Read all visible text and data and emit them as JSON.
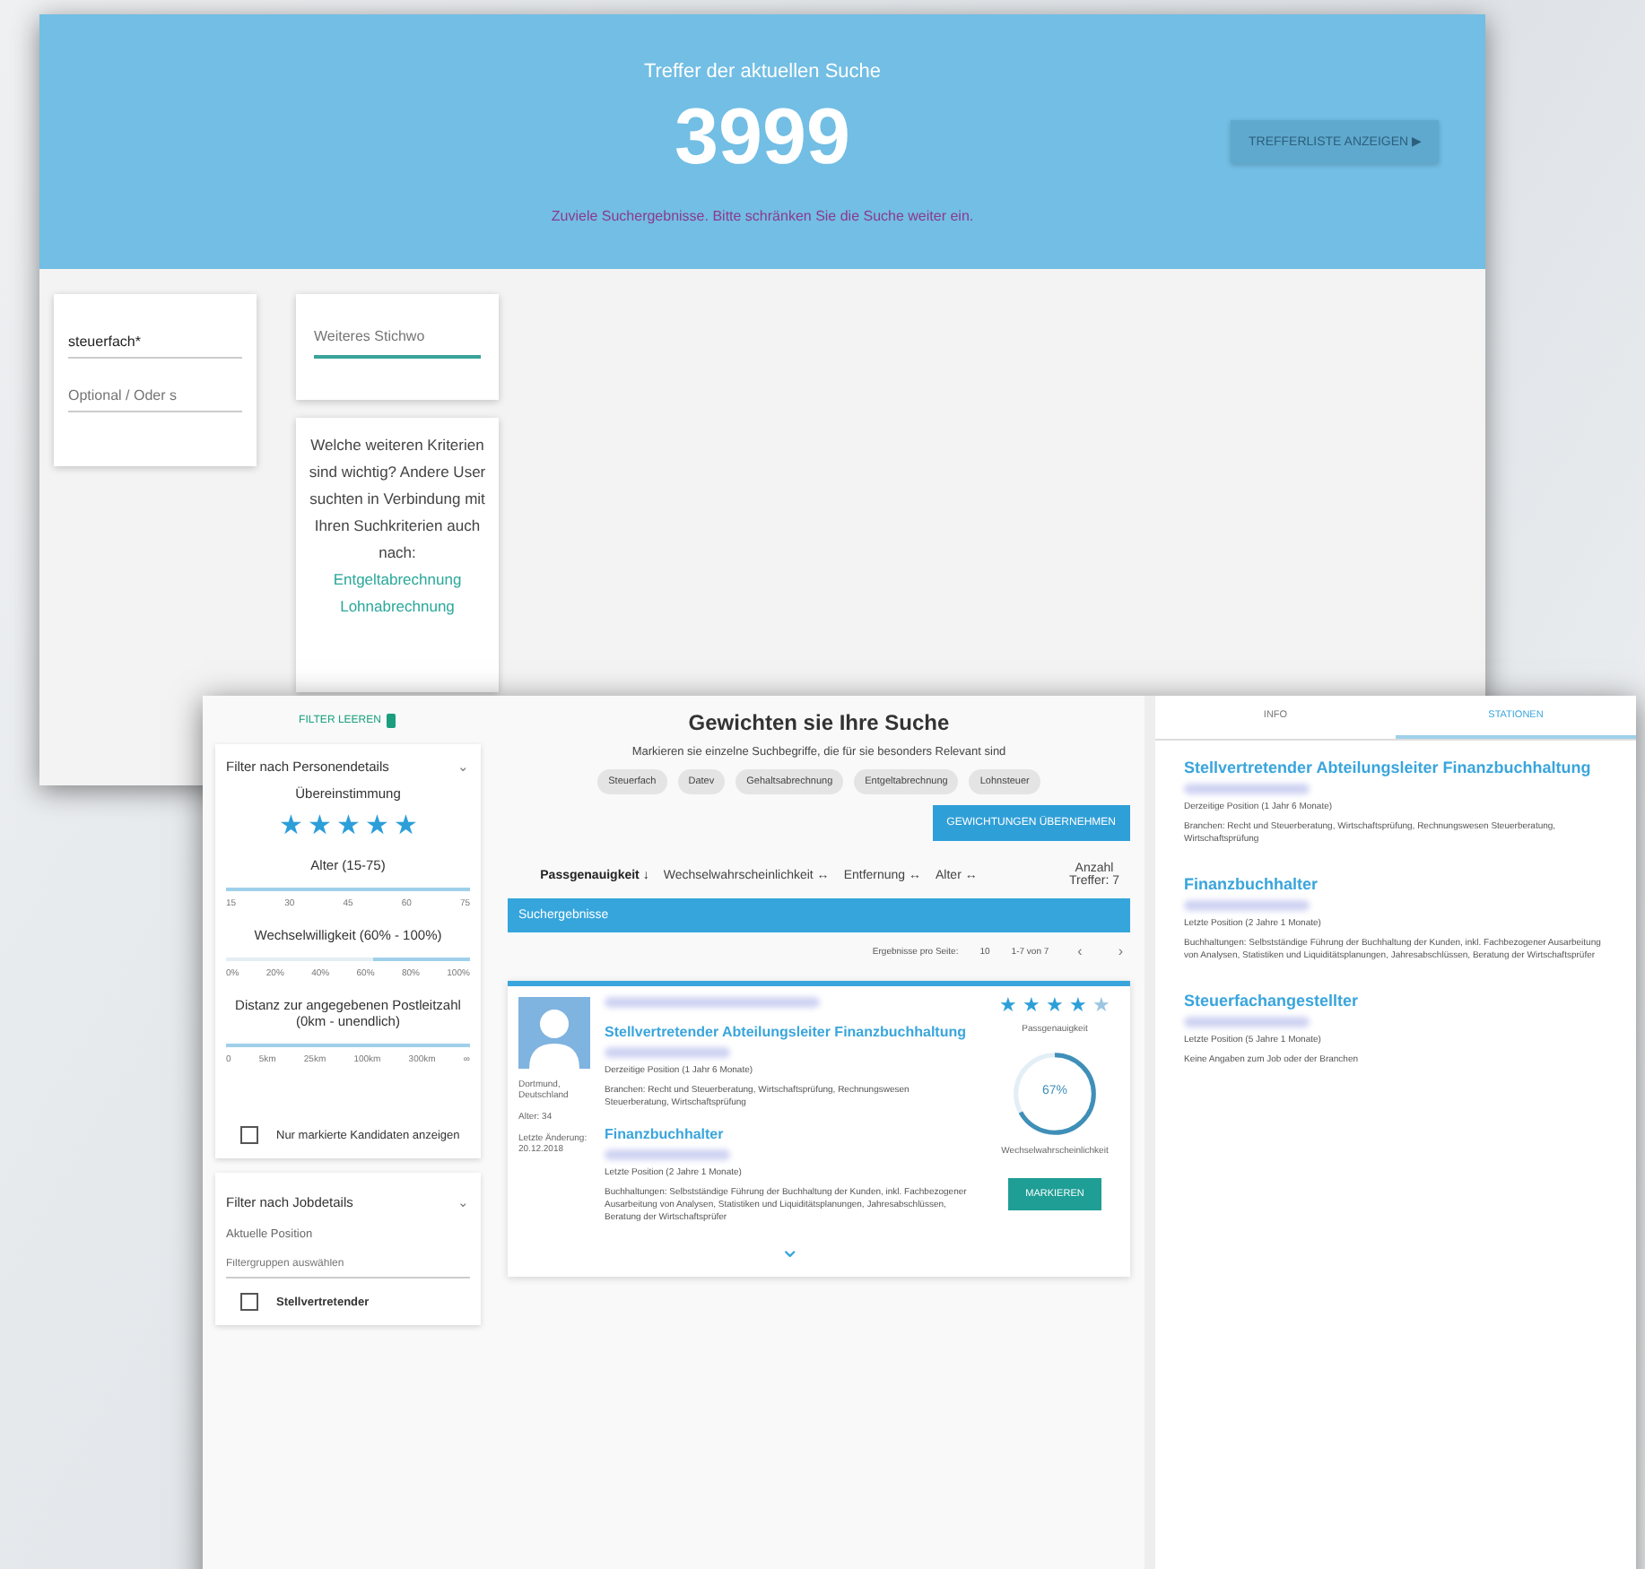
{
  "search_window": {
    "header": {
      "title": "Treffer der aktuellen Suche",
      "count": "3999",
      "button": "TREFFERLISTE ANZEIGEN ▶",
      "warning": "Zuviele Suchergebnisse. Bitte schränken Sie die Suche weiter ein."
    },
    "term_card": {
      "value": "steuerfach*",
      "placeholder": "Optional / Oder s"
    },
    "suggest_card": {
      "placeholder": "Weiteres Stichwo",
      "tooltip": "Welche weiteren Kriterien sind wichtig? Andere User suchten in Verbindung mit Ihren Suchkriterien auch nach:",
      "links": [
        "Entgeltabrechnung",
        "Lohnabrechnung"
      ]
    }
  },
  "results_window": {
    "sidebar": {
      "clear_button": "FILTER LEEREN",
      "person_filter": {
        "title": "Filter nach Personendetails",
        "toggle": "⌄",
        "match_label": "Übereinstimmung",
        "stars": 5,
        "sliders": [
          {
            "label": "Alter (15-75)",
            "level": 1,
            "ticks": [
              "15",
              "30",
              "45",
              "60",
              "75"
            ]
          },
          {
            "label": "Wechselwilligkeit (60% - 100%)",
            "level": 0.4,
            "ticks": [
              "0%",
              "20%",
              "40%",
              "60%",
              "80%",
              "100%"
            ]
          },
          {
            "label": "Distanz zur angegebenen Postleitzahl (0km - unendlich)",
            "level": 1,
            "ticks": [
              "0",
              "5km",
              "25km",
              "100km",
              "300km",
              "∞"
            ]
          }
        ],
        "only_marked": {
          "label": "Nur markierte Kandidaten anzeigen",
          "checked": false
        }
      },
      "job_filter": {
        "title": "Filter nach Jobdetails",
        "toggle": "⌄",
        "field_label": "Aktuelle Position",
        "placeholder": "Filtergruppen auswählen",
        "option": {
          "label": "Stellvertretender",
          "checked": false
        }
      }
    },
    "main": {
      "title": "Gewichten sie Ihre Suche",
      "subtitle": "Markieren sie einzelne Suchbegriffe, die für sie besonders Relevant sind",
      "chips": [
        "Steuerfach",
        "Datev",
        "Gehaltsabrechnung",
        "Entgeltabrechnung",
        "Lohnsteuer"
      ],
      "apply_button": "GEWICHTUNGEN ÜBERNEHMEN",
      "sorts": [
        {
          "label": "Passgenauigkeit ↓",
          "selected": true
        },
        {
          "label": "Wechselwahrscheinlichkeit ↔",
          "selected": false
        },
        {
          "label": "Entfernung ↔",
          "selected": false
        },
        {
          "label": "Alter ↔",
          "selected": false
        }
      ],
      "hit_count": "Anzahl Treffer: 7",
      "results_bar": "Suchergebnisse",
      "pager": {
        "per_page_label": "Ergebnisse pro Seite:",
        "per_page": "10",
        "range": "1-7 von 7",
        "prev": "‹",
        "next": "›"
      },
      "candidate": {
        "location": "Dortmund, Deutschland",
        "age": "Alter: 34",
        "changed": "Letzte Änderung: 20.12.2018",
        "stars": 4,
        "stars_label": "Passgenauigkeit",
        "percent": "67%",
        "level": 0.67,
        "gauge_label": "Wechselwahrscheinlichkeit",
        "button": "MARKIEREN",
        "expand": "⌄",
        "jobs": [
          {
            "title": "Stellvertretender Abteilungsleiter Finanzbuchhaltung",
            "period": "Derzeitige Position (1 Jahr 6 Monate)",
            "details": "Branchen: Recht und Steuerberatung, Wirtschaftsprüfung, Rechnungswesen Steuerberatung, Wirtschaftsprüfung"
          },
          {
            "title": "Finanzbuchhalter",
            "period": "Letzte Position (2 Jahre 1 Monate)",
            "details": "Buchhaltungen: Selbstständige Führung der Buchhaltung der Kunden, inkl. Fachbezogener Ausarbeitung von Analysen, Statistiken und Liquiditätsplanungen, Jahresabschlüssen, Beratung der Wirtschaftsprüfer"
          }
        ]
      }
    },
    "detail": {
      "tabs": [
        {
          "label": "INFO",
          "selected": false
        },
        {
          "label": "STATIONEN",
          "selected": true
        }
      ],
      "stations": [
        {
          "title": "Stellvertretender Abteilungsleiter Finanzbuchhaltung",
          "period": "Derzeitige Position (1 Jahr 6 Monate)",
          "details": "Branchen: Recht und Steuerberatung, Wirtschaftsprüfung, Rechnungswesen Steuerberatung, Wirtschaftsprüfung"
        },
        {
          "title": "Finanzbuchhalter",
          "period": "Letzte Position (2 Jahre 1 Monate)",
          "details": "Buchhaltungen: Selbstständige Führung der Buchhaltung der Kunden, inkl. Fachbezogener Ausarbeitung von Analysen, Statistiken und Liquiditätsplanungen, Jahresabschlüssen, Beratung der Wirtschaftsprüfer"
        },
        {
          "title": "Steuerfachangestellter",
          "period": "Letzte Position (5 Jahre 1 Monate)",
          "details": "Keine Angaben zum Job oder der Branchen"
        }
      ]
    }
  }
}
